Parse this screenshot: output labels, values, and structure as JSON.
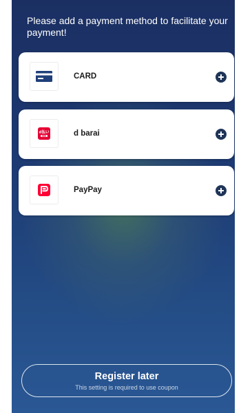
{
  "header": {
    "message": "Please add a payment method to facilitate your payment!"
  },
  "payment_methods": [
    {
      "label": "CARD",
      "icon": "credit-card-icon",
      "icon_color": "#1f3f7a",
      "action_icon": "add-circle-icon"
    },
    {
      "label": "d barai",
      "icon": "d-barai-logo",
      "icon_color": "#e60033",
      "logo_text": "d払い",
      "action_icon": "add-circle-icon"
    },
    {
      "label": "PayPay",
      "icon": "paypay-logo",
      "icon_color": "#ff0033",
      "action_icon": "add-circle-icon"
    }
  ],
  "register_later": {
    "title": "Register later",
    "subtitle": "This setting is required to use coupon"
  },
  "colors": {
    "background_top": "#1b2f62",
    "background_bottom": "#2a5895",
    "accent_dark": "#1f3558"
  }
}
